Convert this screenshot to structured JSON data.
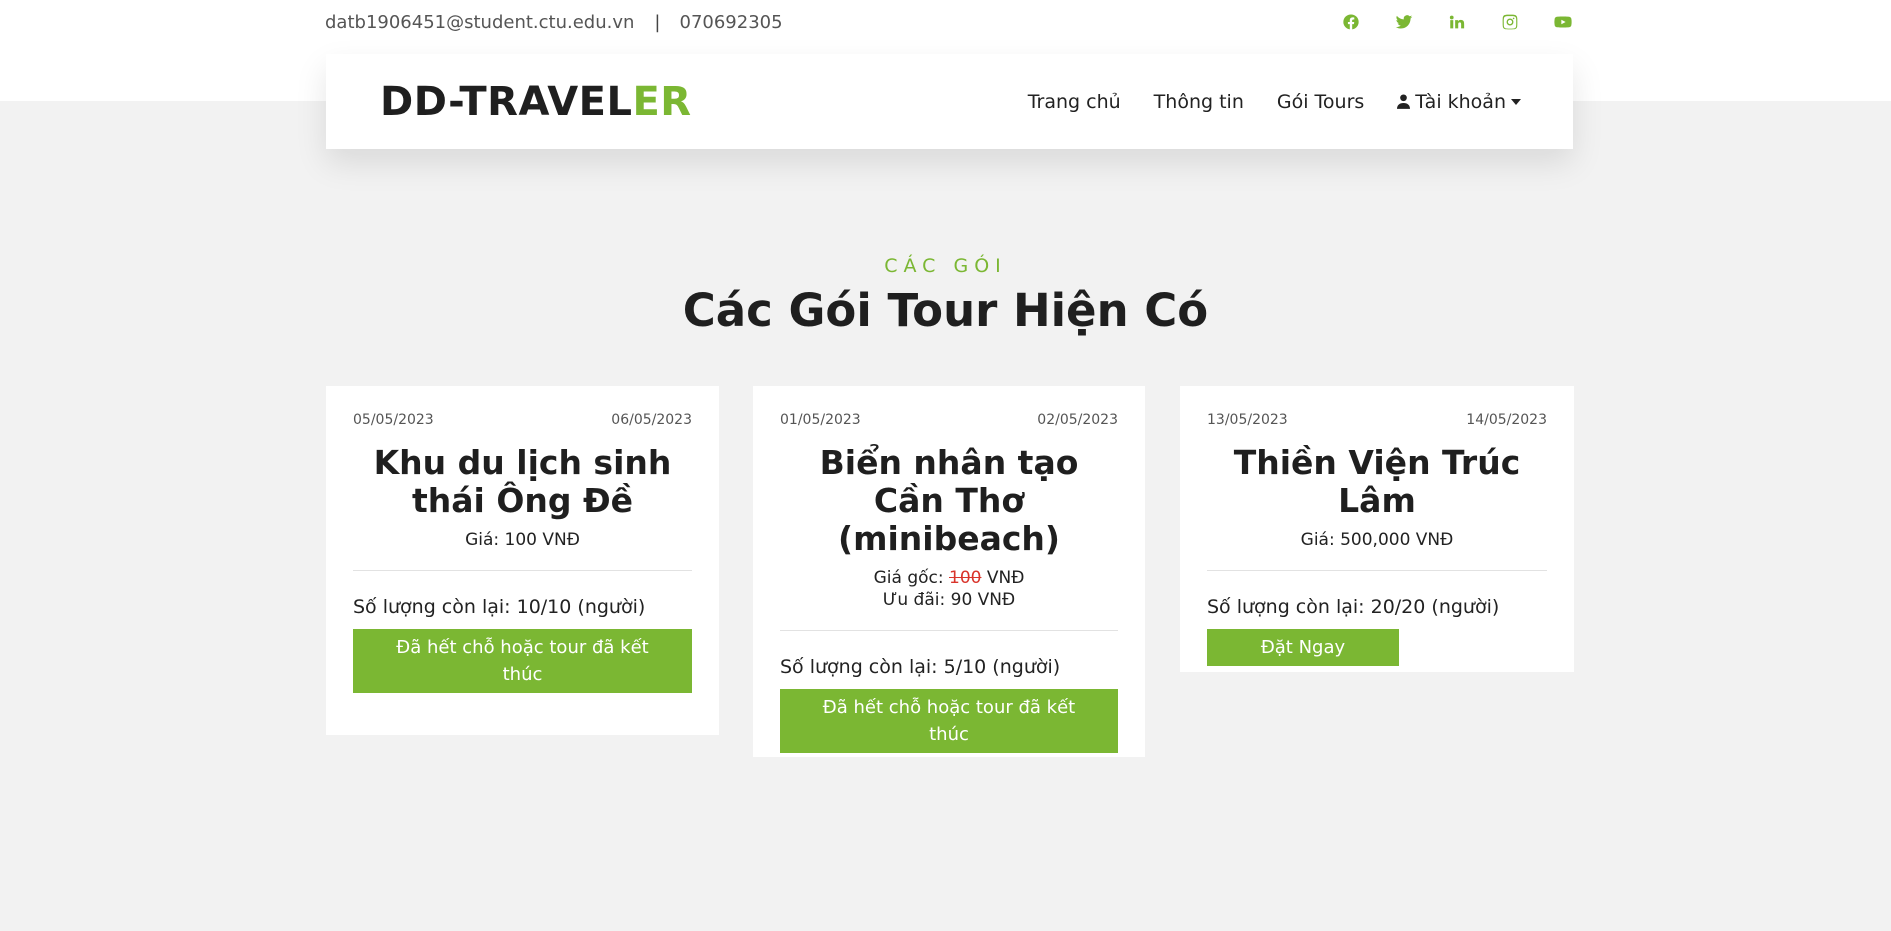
{
  "topbar": {
    "email": "datb1906451@student.ctu.edu.vn",
    "separator": "|",
    "phone": "070692305",
    "socials": [
      "facebook-icon",
      "twitter-icon",
      "linkedin-icon",
      "instagram-icon",
      "youtube-icon"
    ]
  },
  "brand": {
    "logo_main": "DD-TRAVEL",
    "logo_accent": "ER",
    "accent_color": "#7bb733"
  },
  "nav": {
    "home": "Trang chủ",
    "info": "Thông tin",
    "tours": "Gói Tours",
    "account": "Tài khoản"
  },
  "section": {
    "subtitle": "CÁC GÓI",
    "title": "Các Gói Tour Hiện Có"
  },
  "cards": [
    {
      "start_date": "05/05/2023",
      "end_date": "06/05/2023",
      "title": "Khu du lịch sinh thái Ông Đề",
      "price": "Giá: 100 VNĐ",
      "remaining": "Số lượng còn lại: 10/10 (người)",
      "button": "Đã hết chỗ hoặc tour đã kết thúc"
    },
    {
      "start_date": "01/05/2023",
      "end_date": "02/05/2023",
      "title": "Biển nhân tạo Cần Thơ (minibeach)",
      "original_price_label": "Giá gốc: ",
      "original_price_value": "100",
      "original_price_unit": " VNĐ",
      "discount_price": "Ưu đãi: 90 VNĐ",
      "remaining": "Số lượng còn lại: 5/10 (người)",
      "button": "Đã hết chỗ hoặc tour đã kết thúc"
    },
    {
      "start_date": "13/05/2023",
      "end_date": "14/05/2023",
      "title": "Thiền Viện Trúc Lâm",
      "price": "Giá: 500,000 VNĐ",
      "remaining": "Số lượng còn lại: 20/20 (người)",
      "button": "Đặt Ngay"
    }
  ]
}
